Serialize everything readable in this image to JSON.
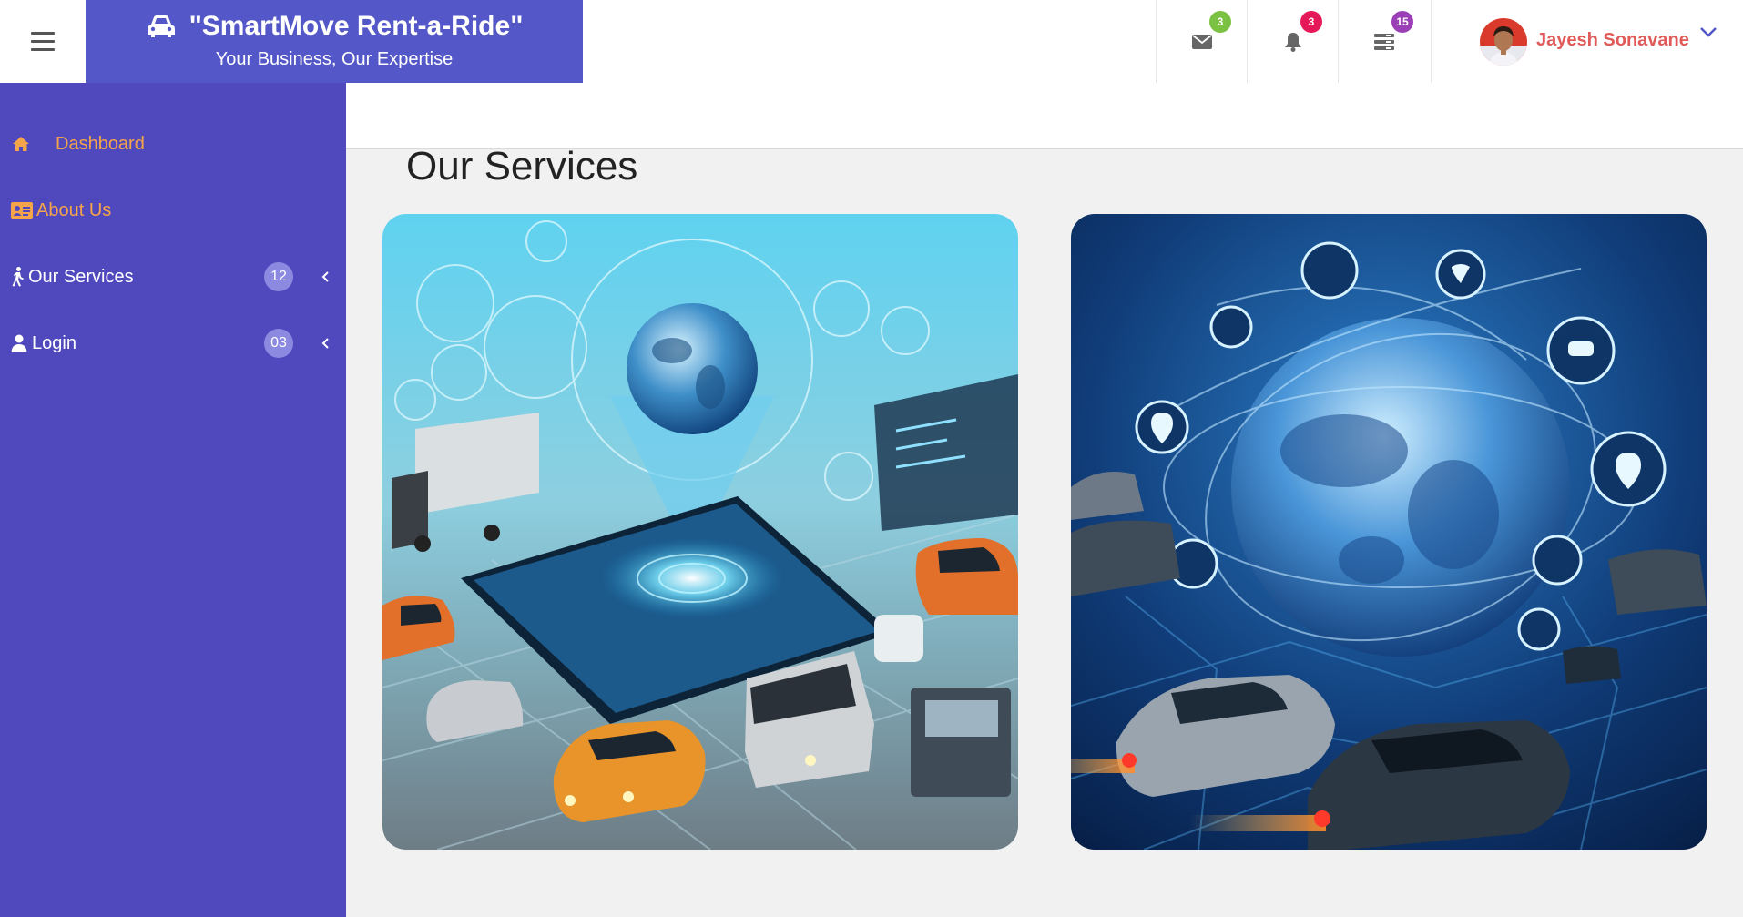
{
  "header": {
    "brand_title": "\"SmartMove Rent-a-Ride\"",
    "brand_tagline": "Your Business, Our Expertise",
    "notifications": [
      {
        "name": "messages",
        "icon": "envelope-icon",
        "count": "3",
        "color": "#7cc242"
      },
      {
        "name": "alerts",
        "icon": "bell-icon",
        "count": "3",
        "color": "#e5185a"
      },
      {
        "name": "tasks",
        "icon": "list-icon",
        "count": "15",
        "color": "#9b3fb6"
      }
    ],
    "user": {
      "name": "Jayesh Sonavane"
    }
  },
  "sidebar": {
    "items": [
      {
        "label": "Dashboard",
        "icon": "home-icon",
        "color": "#f5a44a"
      },
      {
        "label": "About Us",
        "icon": "id-card-icon",
        "color": "#f5a44a"
      },
      {
        "label": "Our Services",
        "icon": "walking-icon",
        "color": "#ffffff",
        "count": "12",
        "chevron": "chevron-left-icon"
      },
      {
        "label": "Login",
        "icon": "user-icon",
        "color": "#ffffff",
        "count": "03",
        "chevron": "chevron-left-icon"
      }
    ]
  },
  "main": {
    "title": "Our Services",
    "cards": [
      {
        "name": "service-card-logistics"
      },
      {
        "name": "service-card-global-network"
      }
    ]
  },
  "colors": {
    "brand": "#5457c7",
    "sidebar": "#5049bd",
    "accent_orange": "#f5a44a",
    "user_name": "#e15a5a"
  }
}
